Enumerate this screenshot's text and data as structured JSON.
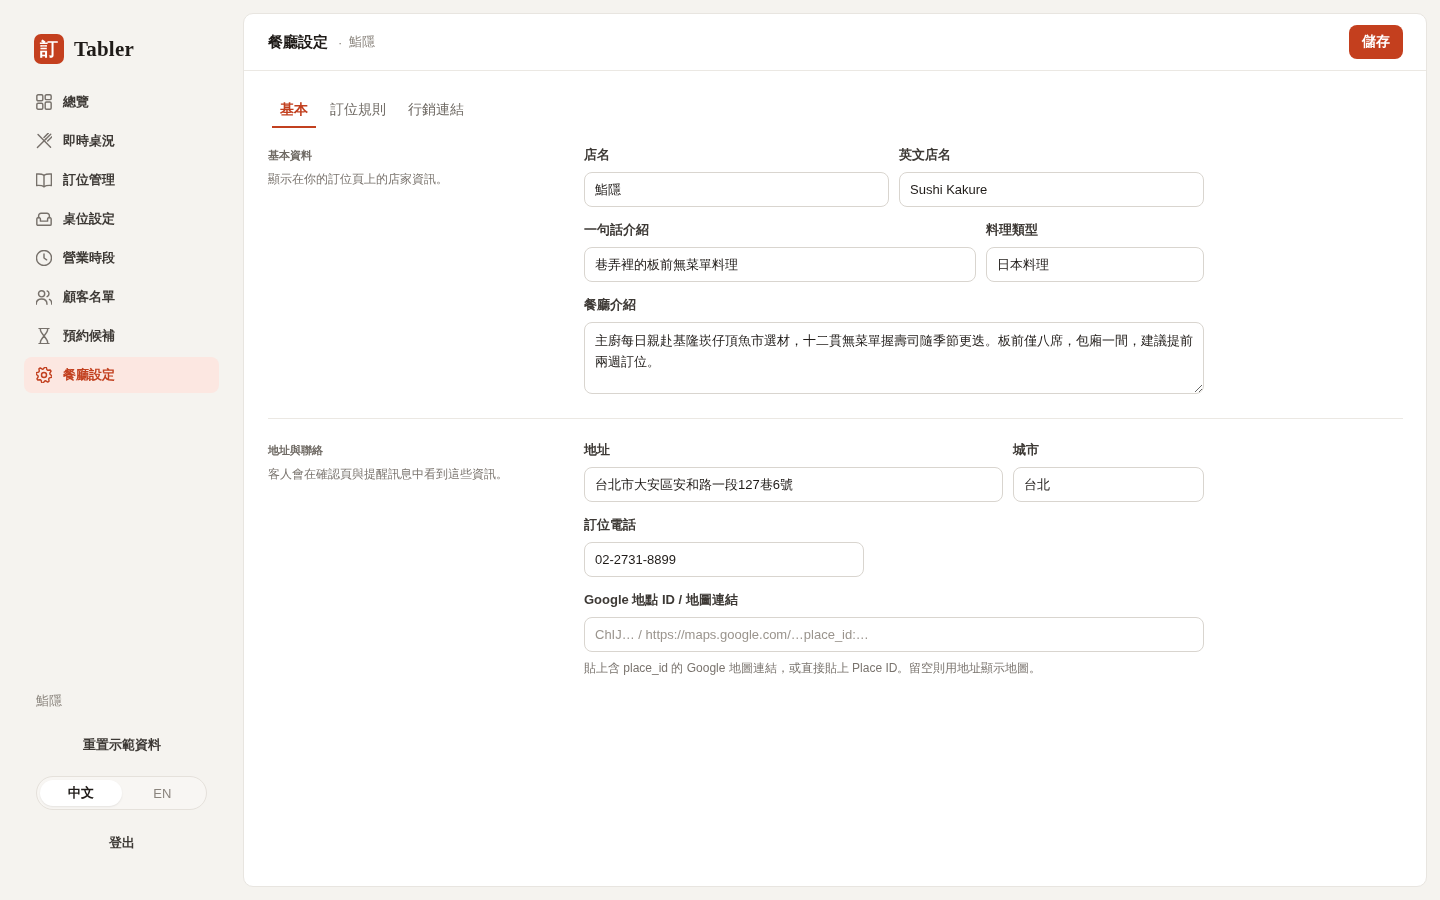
{
  "sidebar": {
    "brand": {
      "logo_text": "訂",
      "name": "Tabler"
    },
    "nav": [
      {
        "label": "總覽",
        "selected": false
      },
      {
        "label": "即時桌況",
        "selected": false
      },
      {
        "label": "訂位管理",
        "selected": false
      },
      {
        "label": "桌位設定",
        "selected": false
      },
      {
        "label": "營業時段",
        "selected": false
      },
      {
        "label": "顧客名單",
        "selected": false
      },
      {
        "label": "預約候補",
        "selected": false
      },
      {
        "label": "餐廳設定",
        "selected": true
      }
    ],
    "footer": {
      "restaurant": "鮨隱",
      "reset_button": "重置示範資料",
      "languages": [
        {
          "label": "中文",
          "selected": true
        },
        {
          "label": "EN",
          "selected": false
        }
      ],
      "logout": "登出"
    }
  },
  "header": {
    "title": "餐廳設定",
    "separator": "·",
    "subtitle": "鮨隱",
    "save_button": "儲存"
  },
  "tabs": [
    {
      "label": "基本",
      "selected": true
    },
    {
      "label": "訂位規則",
      "selected": false
    },
    {
      "label": "行銷連結",
      "selected": false
    }
  ],
  "sections": [
    {
      "title": "基本資料",
      "description": "顯示在你的訂位頁上的店家資訊。",
      "rows": [
        {
          "fields": [
            {
              "kind": "text",
              "label": "店名",
              "value": "鮨隱"
            },
            {
              "kind": "text",
              "label": "英文店名",
              "value": "Sushi Kakure"
            }
          ]
        },
        {
          "fields": [
            {
              "kind": "text",
              "label": "一句話介紹",
              "value": "巷弄裡的板前無菜單料理"
            },
            {
              "kind": "text",
              "label": "料理類型",
              "value": "日本料理"
            }
          ]
        },
        {
          "fields": [
            {
              "kind": "textarea",
              "label": "餐廳介紹",
              "value": "主廚每日親赴基隆崁仔頂魚市選材，十二貫無菜單握壽司隨季節更迭。板前僅八席，包廂一間，建議提前兩週訂位。"
            }
          ]
        }
      ]
    },
    {
      "title": "地址與聯絡",
      "description": "客人會在確認頁與提醒訊息中看到這些資訊。",
      "rows": [
        {
          "fields": [
            {
              "kind": "text",
              "label": "地址",
              "value": "台北市大安區安和路一段127巷6號"
            },
            {
              "kind": "text",
              "label": "城市",
              "value": "台北"
            }
          ]
        },
        {
          "fields": [
            {
              "kind": "text",
              "label": "訂位電話",
              "value": "02-2731-8899"
            }
          ]
        },
        {
          "fields": [
            {
              "kind": "text",
              "label": "Google 地點 ID / 地圖連結",
              "placeholder": "ChIJ… / https://maps.google.com/…place_id:…",
              "hint": "貼上含 place_id 的 Google 地圖連結，或直接貼上 Place ID。留空則用地址顯示地圖。"
            }
          ]
        }
      ]
    }
  ]
}
